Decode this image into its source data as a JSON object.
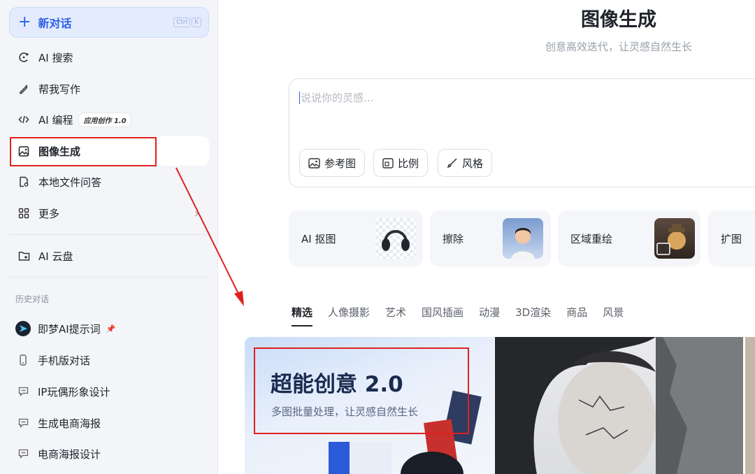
{
  "sidebar": {
    "new_chat": {
      "label": "新对话",
      "shortcut_keys": [
        "Ctrl",
        "K"
      ]
    },
    "items": [
      {
        "label": "AI 搜索",
        "icon": "search-icon"
      },
      {
        "label": "帮我写作",
        "icon": "pen-icon"
      },
      {
        "label": "AI 编程",
        "icon": "code-icon",
        "badge": "应用创作 1.0"
      },
      {
        "label": "图像生成",
        "icon": "image-icon",
        "active": true
      },
      {
        "label": "本地文件问答",
        "icon": "file-icon"
      },
      {
        "label": "更多",
        "icon": "grid-icon"
      }
    ],
    "cloud": {
      "label": "AI 云盘",
      "icon": "folder-icon"
    },
    "history_title": "历史对话",
    "history": [
      {
        "label": "即梦AI提示词",
        "icon": "dreamina-icon",
        "pinned": true
      },
      {
        "label": "手机版对话",
        "icon": "phone-icon"
      },
      {
        "label": "IP玩偶形象设计",
        "icon": "chat-bubble-icon"
      },
      {
        "label": "生成电商海报",
        "icon": "chat-bubble-icon"
      },
      {
        "label": "电商海报设计",
        "icon": "chat-bubble-icon"
      }
    ]
  },
  "main": {
    "title": "图像生成",
    "subtitle": "创意高效迭代，让灵感自然生长",
    "prompt": {
      "placeholder": "说说你的灵感...",
      "value": ""
    },
    "chips": [
      {
        "label": "参考图",
        "icon": "image-icon"
      },
      {
        "label": "比例",
        "icon": "ratio-icon"
      },
      {
        "label": "风格",
        "icon": "brush-icon"
      }
    ],
    "tools": [
      {
        "label": "AI 抠图"
      },
      {
        "label": "擦除"
      },
      {
        "label": "区域重绘"
      },
      {
        "label": "扩图"
      }
    ],
    "tabs": [
      "精选",
      "人像摄影",
      "艺术",
      "国风插画",
      "动漫",
      "3D渲染",
      "商品",
      "风景"
    ],
    "active_tab": "精选",
    "banner": {
      "title": "超能创意 2.0",
      "subtitle": "多图批量处理，让灵感自然生长"
    }
  },
  "colors": {
    "accent": "#2c5fe6",
    "annotation": "#e02020"
  }
}
